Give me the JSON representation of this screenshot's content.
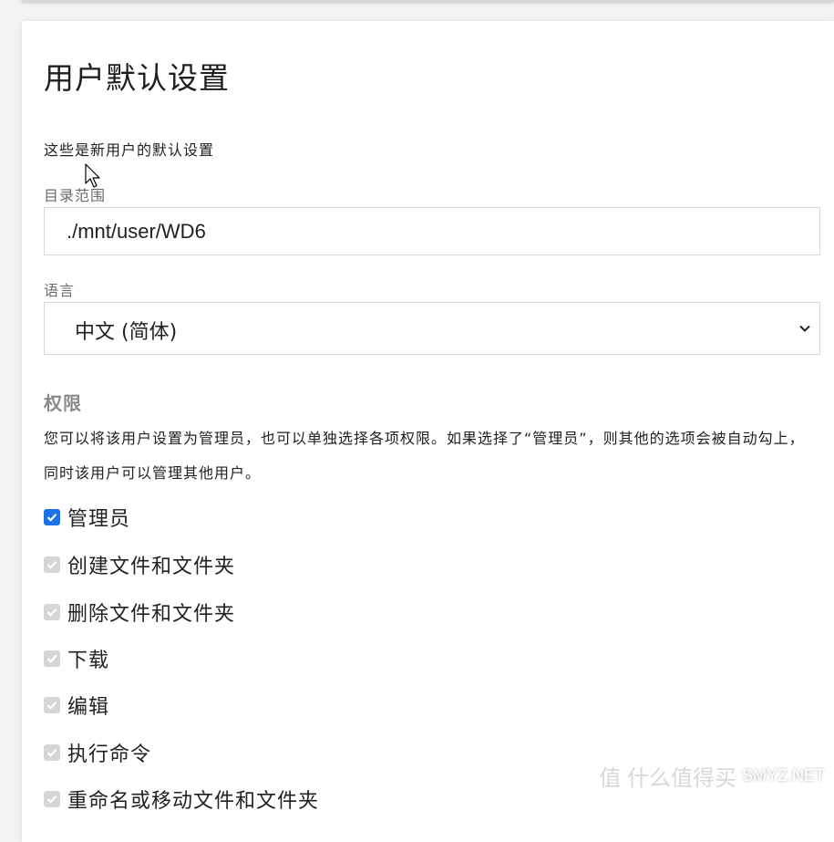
{
  "page": {
    "title": "用户默认设置",
    "description": "这些是新用户的默认设置"
  },
  "scope": {
    "label": "目录范围",
    "value": "./mnt/user/WD6"
  },
  "language": {
    "label": "语言",
    "selected": "中文 (简体)"
  },
  "permissions": {
    "title": "权限",
    "description": "您可以将该用户设置为管理员，也可以单独选择各项权限。如果选择了“管理员”，则其他的选项会被自动勾上，同时该用户可以管理其他用户。",
    "items": [
      {
        "label": "管理员",
        "checked": true,
        "disabled": false
      },
      {
        "label": "创建文件和文件夹",
        "checked": true,
        "disabled": true
      },
      {
        "label": "删除文件和文件夹",
        "checked": true,
        "disabled": true
      },
      {
        "label": "下载",
        "checked": true,
        "disabled": true
      },
      {
        "label": "编辑",
        "checked": true,
        "disabled": true
      },
      {
        "label": "执行命令",
        "checked": true,
        "disabled": true
      },
      {
        "label": "重命名或移动文件和文件夹",
        "checked": true,
        "disabled": true
      }
    ]
  },
  "watermark": {
    "text": "SMYZ.NET",
    "ghost": "值 什么值得买"
  },
  "colors": {
    "accent": "#1a73e8",
    "disabled": "#d6d6d6"
  }
}
